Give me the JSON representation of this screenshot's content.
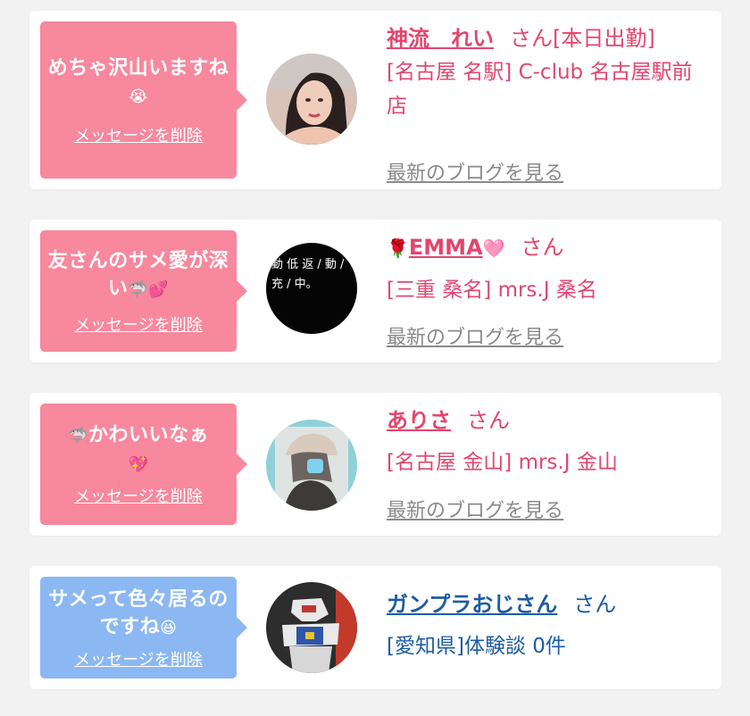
{
  "colors": {
    "pink_bubble": "#f7889d",
    "blue_bubble": "#8bb8f2",
    "pink_text": "#e2466f",
    "blue_text": "#1d5ca5",
    "blog_link": "#8a8a8a"
  },
  "items": [
    {
      "message": "めちゃ沢山いますね",
      "message_emoji": "😭",
      "delete_label": "メッセージを削除",
      "name": "神流　れい",
      "suffix": "さん[本日出勤]",
      "shop": "[名古屋 名駅] C-club 名古屋駅前店",
      "blog_label": "最新のブログを見る"
    },
    {
      "message": "友さんのサメ愛が深い",
      "message_emoji": "🦈💕",
      "delete_label": "メッセージを削除",
      "name_emoji_left": "🌹",
      "name": "EMMA",
      "name_emoji_right": "🩷",
      "suffix": "さん",
      "shop": "[三重 桑名] mrs.J 桑名",
      "avatar_text": "動 低 返 / 動 / 充 / 中。",
      "blog_label": "最新のブログを見る"
    },
    {
      "message_emoji_left": "🦈",
      "message": "かわいいなぁ",
      "message_emoji": "💖",
      "delete_label": "メッセージを削除",
      "name": "ありさ",
      "suffix": "さん",
      "shop": "[名古屋 金山] mrs.J 金山",
      "blog_label": "最新のブログを見る"
    },
    {
      "message": "サメって色々居るのですね",
      "message_emoji": "😆",
      "delete_label": "メッセージを削除",
      "name": "ガンプラおじさん",
      "suffix": "さん",
      "shop": "[愛知県]体験談 0件"
    }
  ]
}
